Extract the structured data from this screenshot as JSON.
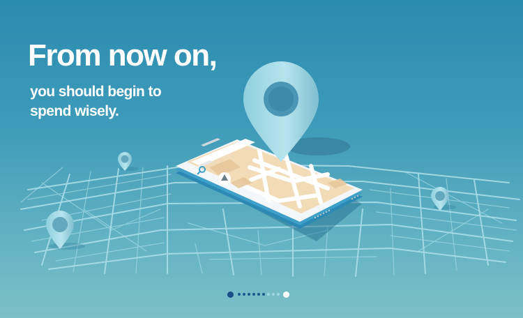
{
  "banner": {
    "headline": "From now on,",
    "subline_1": "you should begin to",
    "subline_2": "spend wisely."
  },
  "carousel": {
    "page_count": 11,
    "active_index": 0
  },
  "illustration": {
    "main_subject": "smartphone-with-map",
    "icons": [
      "map-pin-icon",
      "search-icon",
      "navigation-arrow-icon"
    ]
  },
  "colors": {
    "background_top": "#2a8bb0",
    "background_bottom": "#7cc0c8",
    "pin": "#a6dbe6",
    "map_roads": "#aee0ea",
    "phone_screen": "#f2dcb8",
    "dot_active": "#1a4e86",
    "dot_end": "#ffffff"
  }
}
